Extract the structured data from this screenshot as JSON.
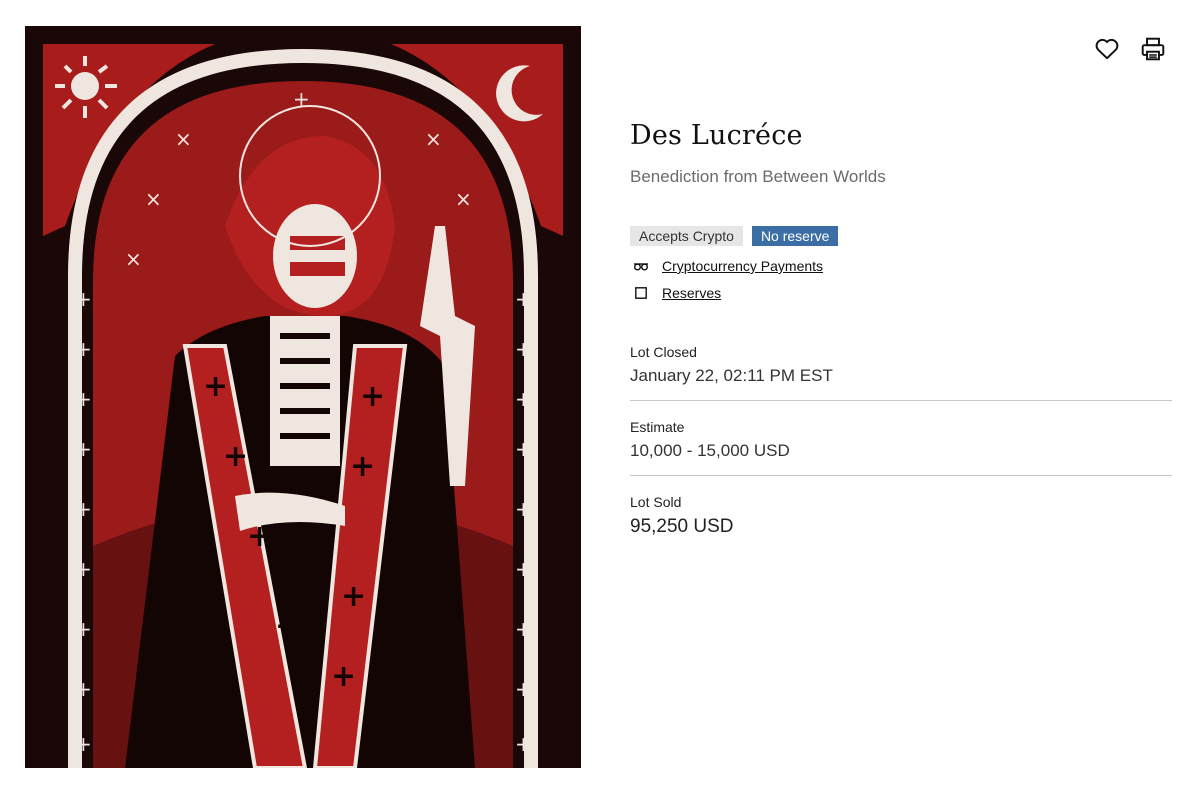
{
  "lot": {
    "artist": "Des Lucréce",
    "title": "Benediction from Between Worlds",
    "badges": {
      "crypto": "Accepts Crypto",
      "reserve": "No reserve"
    },
    "links": {
      "crypto_payments": "Cryptocurrency Payments",
      "reserves": "Reserves"
    },
    "status": {
      "label": "Lot Closed",
      "value": "January 22, 02:11 PM EST"
    },
    "estimate": {
      "label": "Estimate",
      "value": "10,000 - 15,000 USD"
    },
    "sold": {
      "label": "Lot Sold",
      "value": "95,250 USD"
    }
  },
  "icons": {
    "favorite": "heart-icon",
    "print": "printer-icon",
    "crypto": "crypto-glasses-icon",
    "reserve": "square-icon"
  },
  "colors": {
    "badge_grey": "#e6e6e6",
    "badge_blue": "#3b6ea5",
    "art_red": "#b3201f",
    "art_dark": "#1a0707",
    "art_cream": "#efe6df"
  }
}
